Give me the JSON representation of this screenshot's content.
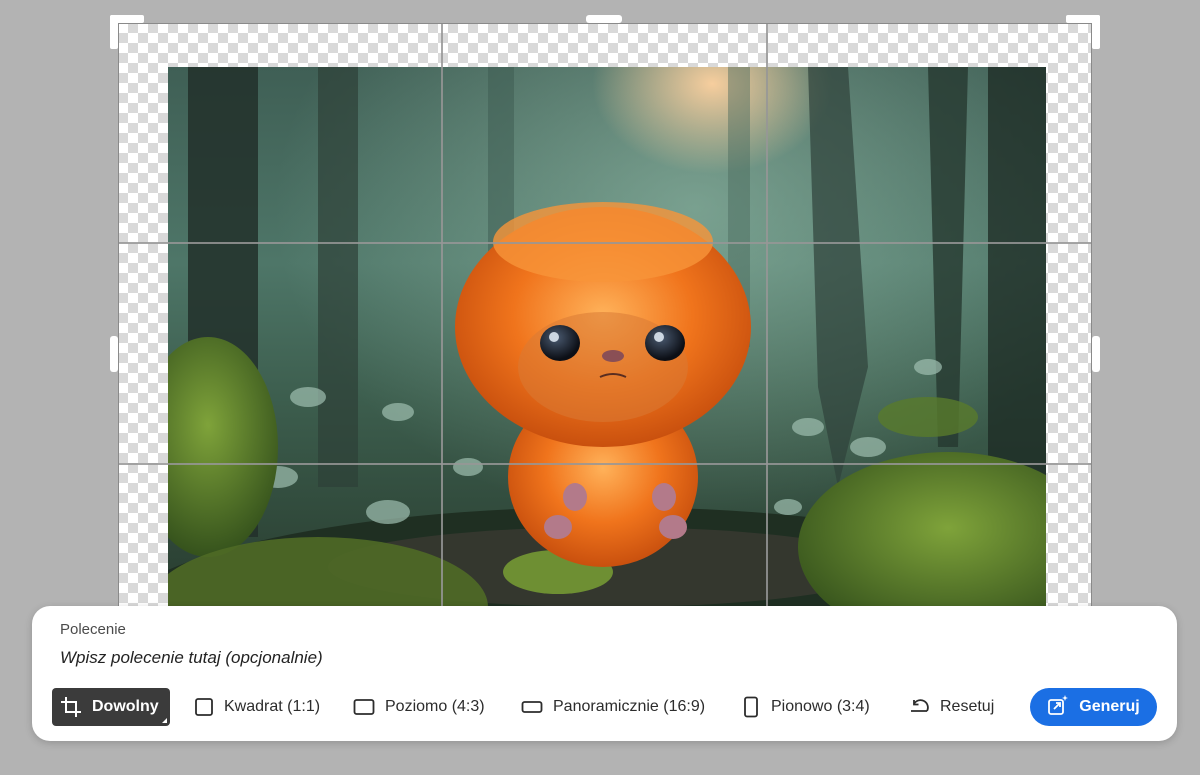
{
  "canvas": {
    "image_alt": "Orange furry creature in a misty forest"
  },
  "panel": {
    "prompt_label": "Polecenie",
    "prompt_placeholder": "Wpisz polecenie tutaj (opcjonalnie)",
    "prompt_value": ""
  },
  "toolbar": {
    "items": [
      {
        "label": "Dowolny",
        "icon": "crop-icon",
        "active": true
      },
      {
        "label": "Kwadrat (1:1)",
        "icon": "square-icon",
        "active": false
      },
      {
        "label": "Poziomo (4:3)",
        "icon": "landscape-icon",
        "active": false
      },
      {
        "label": "Panoramicznie (16:9)",
        "icon": "widescreen-icon",
        "active": false
      },
      {
        "label": "Pionowo (3:4)",
        "icon": "portrait-icon",
        "active": false
      }
    ],
    "reset_label": "Resetuj",
    "reset_icon": "undo-icon",
    "generate_label": "Generuj",
    "generate_icon": "generative-expand-icon"
  },
  "colors": {
    "accent": "#1b6fe4",
    "active_tool_bg": "#3b3b3b",
    "background": "#b3b3b3"
  }
}
